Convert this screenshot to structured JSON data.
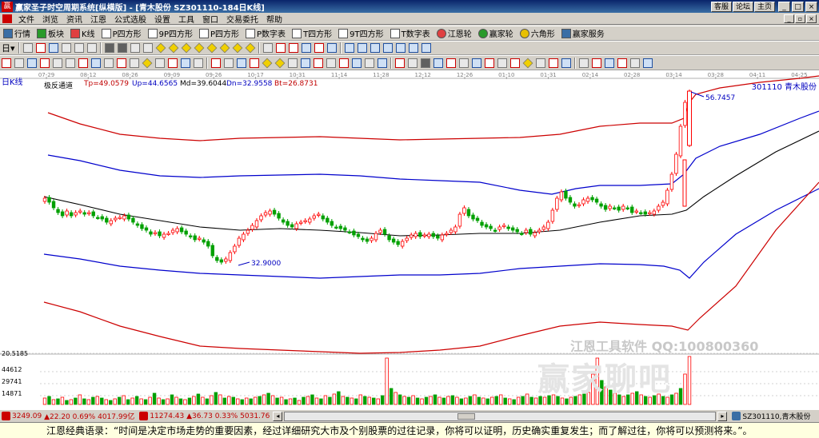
{
  "titlebar": {
    "app_title": "赢家圣子时空周期系统[纵横版] - [青木股份  SZ301110-184日K线]",
    "links": [
      "客服",
      "论坛",
      "主页"
    ],
    "win_buttons": [
      "_",
      "□",
      "×"
    ]
  },
  "menubar": {
    "items": [
      "文件",
      "浏览",
      "资讯",
      "江恩",
      "公式选股",
      "设置",
      "工具",
      "窗口",
      "交易委托",
      "帮助"
    ]
  },
  "toolbar1": {
    "buttons": [
      "行情",
      "板块",
      "K线",
      "P四方形",
      "9P四方形",
      "P四方形",
      "P数字表",
      "T四方形",
      "9T四方形",
      "T数字表",
      "江恩轮",
      "赢家轮",
      "六角形",
      "赢家服务"
    ]
  },
  "toolbar2": {
    "day_dropdown": "日"
  },
  "chart": {
    "period_label": "日K线",
    "indicator_name": "极反通道",
    "tp": "Tp=49.0579",
    "up": "Up=44.6565",
    "md": "Md=39.6044",
    "dn": "Dn=32.9558",
    "bt": "Bt=26.8731",
    "stock_tag": "301110 青木股份",
    "high_label": "56.7457",
    "low_label": "32.9000",
    "date_ticks": [
      "07-29",
      "08-12",
      "08-26",
      "09-09",
      "09-26",
      "10-17",
      "10-31",
      "11-14",
      "11-28",
      "12-12",
      "12-26",
      "01-10",
      "01-31",
      "02-14",
      "02-28",
      "03-14",
      "03-28",
      "04-11",
      "04-25"
    ],
    "volume_ticks": [
      "20.5185",
      "44612",
      "29741",
      "14871"
    ],
    "watermark_line": "江恩工具软件  QQ:100800360",
    "watermark_big": "赢家聊吧",
    "colors": {
      "up_candle": "#ff0000",
      "down_candle": "#00a000",
      "upper_band": "#cc0000",
      "mid_band": "#0000cc",
      "md_line": "#000000"
    }
  },
  "statusbar": {
    "sh_index": "3249.09",
    "sh_change": "▲22.20 0.69% 4017.99亿",
    "sz_index": "11274.43",
    "sz_change": "▲36.73 0.33% 5031.76",
    "stock": "SZ301110,青木股份"
  },
  "quote": {
    "text": "江恩经典语录：“时间是决定市场走势的重要因素，经过详细研究大市及个别股票的过往记录，你将可以证明，历史确实重复发生；而了解过往，你将可以预测将来。”。"
  }
}
